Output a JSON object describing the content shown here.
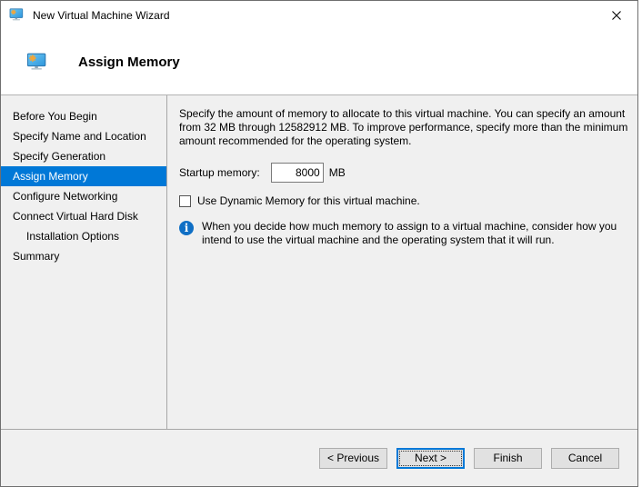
{
  "window": {
    "title": "New Virtual Machine Wizard"
  },
  "header": {
    "title": "Assign Memory"
  },
  "sidebar": {
    "items": [
      {
        "label": "Before You Begin",
        "active": false,
        "indent": false
      },
      {
        "label": "Specify Name and Location",
        "active": false,
        "indent": false
      },
      {
        "label": "Specify Generation",
        "active": false,
        "indent": false
      },
      {
        "label": "Assign Memory",
        "active": true,
        "indent": false
      },
      {
        "label": "Configure Networking",
        "active": false,
        "indent": false
      },
      {
        "label": "Connect Virtual Hard Disk",
        "active": false,
        "indent": false
      },
      {
        "label": "Installation Options",
        "active": false,
        "indent": true
      },
      {
        "label": "Summary",
        "active": false,
        "indent": false
      }
    ]
  },
  "main": {
    "description": "Specify the amount of memory to allocate to this virtual machine. You can specify an amount from 32 MB through 12582912 MB. To improve performance, specify more than the minimum amount recommended for the operating system.",
    "startup_memory": {
      "label": "Startup memory:",
      "value": "8000",
      "unit": "MB"
    },
    "dynamic_memory": {
      "label": "Use Dynamic Memory for this virtual machine.",
      "checked": false
    },
    "info_note": "When you decide how much memory to assign to a virtual machine, consider how you intend to use the virtual machine and the operating system that it will run."
  },
  "footer": {
    "previous_label": "< Previous",
    "next_label": "Next >",
    "finish_label": "Finish",
    "cancel_label": "Cancel"
  },
  "icons": {
    "titlebar": "vm-monitor-icon",
    "header": "vm-monitor-icon",
    "close": "close-icon",
    "info": "info-icon"
  },
  "colors": {
    "highlight": "#0078D7",
    "info_icon": "#0F6FC5",
    "body_background": "#F0F0F0",
    "button_face": "#E1E1E1"
  }
}
